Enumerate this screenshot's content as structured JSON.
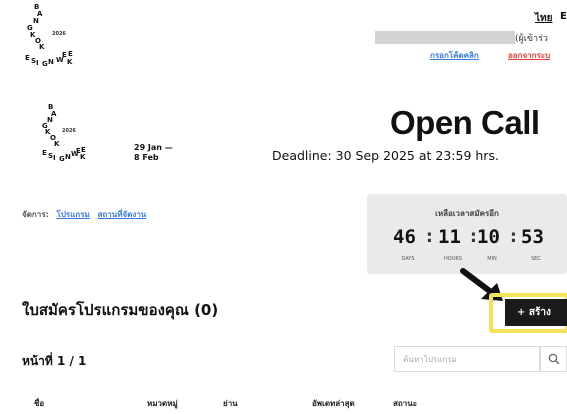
{
  "brand": {
    "logo_letters": [
      "B",
      "A",
      "N",
      "G",
      "K",
      "O",
      "K",
      "D",
      "E",
      "S",
      "I",
      "G",
      "N",
      "W",
      "E",
      "E",
      "K"
    ],
    "year": "2026"
  },
  "header": {
    "lang_th": "ไทย",
    "lang_en": "E",
    "user_suffix": "(ผู้เข้าร่ว",
    "link_enter_code": "กรอกโค้ดคลิก",
    "link_logout": "ออกจากระบ"
  },
  "event": {
    "date_line1": "29 Jan —",
    "date_line2": "8 Feb",
    "title": "Open Call",
    "deadline": "Deadline: 30 Sep 2025 at 23:59 hrs."
  },
  "manage_menu": {
    "label": "จัดการ:",
    "items": [
      "โปรแกรม",
      "สถานที่จัดงาน"
    ]
  },
  "countdown": {
    "title": "เหลือเวลาสมัครอีก",
    "days": "46",
    "hours": "11",
    "minutes": "10",
    "seconds": "53",
    "days_label": "DAYS",
    "hours_label": "HOURS",
    "minutes_label": "MIN",
    "seconds_label": "SEC"
  },
  "applications": {
    "title": "ใบสมัครโปรแกรมของคุณ (0)",
    "create_label": "+ สร้าง",
    "page_label": "หน้าที่ 1 / 1",
    "search_placeholder": "ค้นหาโปรแกรม",
    "columns": [
      "ชื่อ",
      "หมวดหมู่",
      "ย่าน",
      "อัพเดทล่าสุด",
      "สถานะ"
    ]
  },
  "colors": {
    "accent_link": "#3b7be0",
    "logout_red": "#e0453b",
    "highlight": "#f3e35a",
    "countdown_bg": "#e9eaec"
  }
}
